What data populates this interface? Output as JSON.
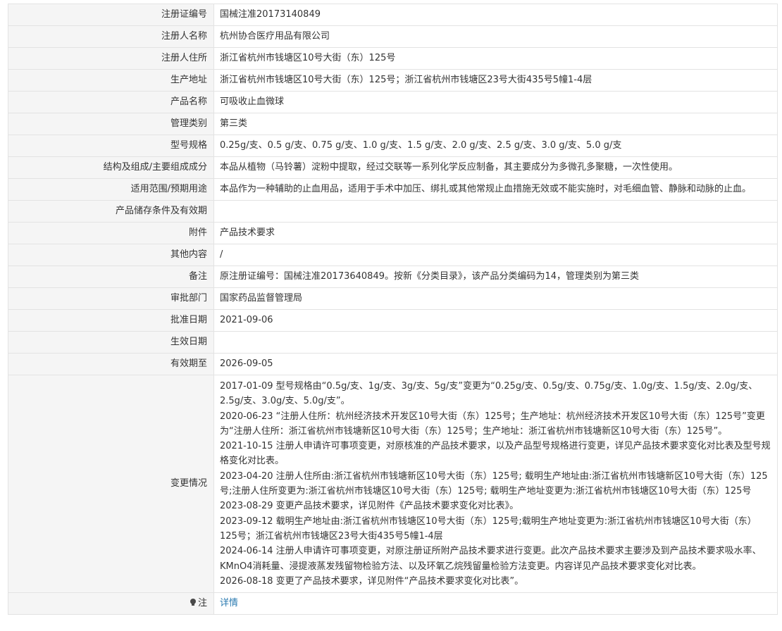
{
  "rows": [
    {
      "label": "注册证编号",
      "value": "国械注准20173140849"
    },
    {
      "label": "注册人名称",
      "value": "杭州协合医疗用品有限公司"
    },
    {
      "label": "注册人住所",
      "value": "浙江省杭州市钱塘区10号大街（东）125号"
    },
    {
      "label": "生产地址",
      "value": "浙江省杭州市钱塘区10号大街（东）125号；浙江省杭州市钱塘区23号大街435号5幢1-4层"
    },
    {
      "label": "产品名称",
      "value": "可吸收止血微球"
    },
    {
      "label": "管理类别",
      "value": "第三类"
    },
    {
      "label": "型号规格",
      "value": "0.25g/支、0.5 g/支、0.75 g/支、1.0 g/支、1.5 g/支、2.0 g/支、2.5 g/支、3.0 g/支、5.0 g/支"
    },
    {
      "label": "结构及组成/主要组成成分",
      "value": "本品从植物（马铃薯）淀粉中提取，经过交联等一系列化学反应制备，其主要成分为多微孔多聚糖，一次性使用。"
    },
    {
      "label": "适用范围/预期用途",
      "value": "本品作为一种辅助的止血用品，适用于手术中加压、绑扎或其他常规止血措施无效或不能实施时，对毛细血管、静脉和动脉的止血。"
    },
    {
      "label": "产品储存条件及有效期",
      "value": ""
    },
    {
      "label": "附件",
      "value": "产品技术要求"
    },
    {
      "label": "其他内容",
      "value": "/"
    },
    {
      "label": "备注",
      "value": "原注册证编号：国械注准20173640849。按新《分类目录》，该产品分类编码为14，管理类别为第三类"
    },
    {
      "label": "审批部门",
      "value": "国家药品监督管理局"
    },
    {
      "label": "批准日期",
      "value": "2021-09-06"
    },
    {
      "label": "生效日期",
      "value": ""
    },
    {
      "label": "有效期至",
      "value": "2026-09-05"
    }
  ],
  "changes": {
    "label": "变更情况",
    "entries": [
      "2017-01-09 型号规格由“0.5g/支、1g/支、3g/支、5g/支”变更为“0.25g/支、0.5g/支、0.75g/支、1.0g/支、1.5g/支、2.0g/支、2.5g/支、3.0g/支、5.0g/支”。",
      "2020-06-23 “注册人住所：杭州经济技术开发区10号大街（东）125号；生产地址：杭州经济技术开发区10号大街（东）125号”变更为“注册人住所：浙江省杭州市钱塘新区10号大街（东）125号；生产地址：浙江省杭州市钱塘新区10号大街（东）125号”。",
      "2021-10-15 注册人申请许可事项变更，对原核准的产品技术要求，以及产品型号规格进行变更，详见产品技术要求变化对比表及型号规格变化对比表。",
      "2023-04-20 注册人住所由:浙江省杭州市钱塘新区10号大街（东）125号; 载明生产地址由:浙江省杭州市钱塘新区10号大街（东）125号;注册人住所变更为:浙江省杭州市钱塘区10号大街（东）125号; 载明生产地址变更为:浙江省杭州市钱塘区10号大街（东）125号",
      "2023-08-29 变更产品技术要求，详见附件《产品技术要求变化对比表》。",
      "2023-09-12 载明生产地址由:浙江省杭州市钱塘区10号大街（东）125号;载明生产地址变更为:浙江省杭州市钱塘区10号大街（东）125号；浙江省杭州市钱塘区23号大街435号5幢1-4层",
      "2024-06-14 注册人申请许可事项变更，对原注册证所附产品技术要求进行变更。此次产品技术要求主要涉及到产品技术要求吸水率、KMnO4消耗量、浸提液蒸发残留物检验方法、以及环氧乙烷残留量检验方法变更。内容详见产品技术要求变化对比表。",
      "2026-08-18 变更了产品技术要求，详见附件“产品技术要求变化对比表”。"
    ]
  },
  "note": {
    "label": "注",
    "icon": "lightbulb-icon",
    "link_text": "详情",
    "link_color": "#2a7ab0"
  }
}
